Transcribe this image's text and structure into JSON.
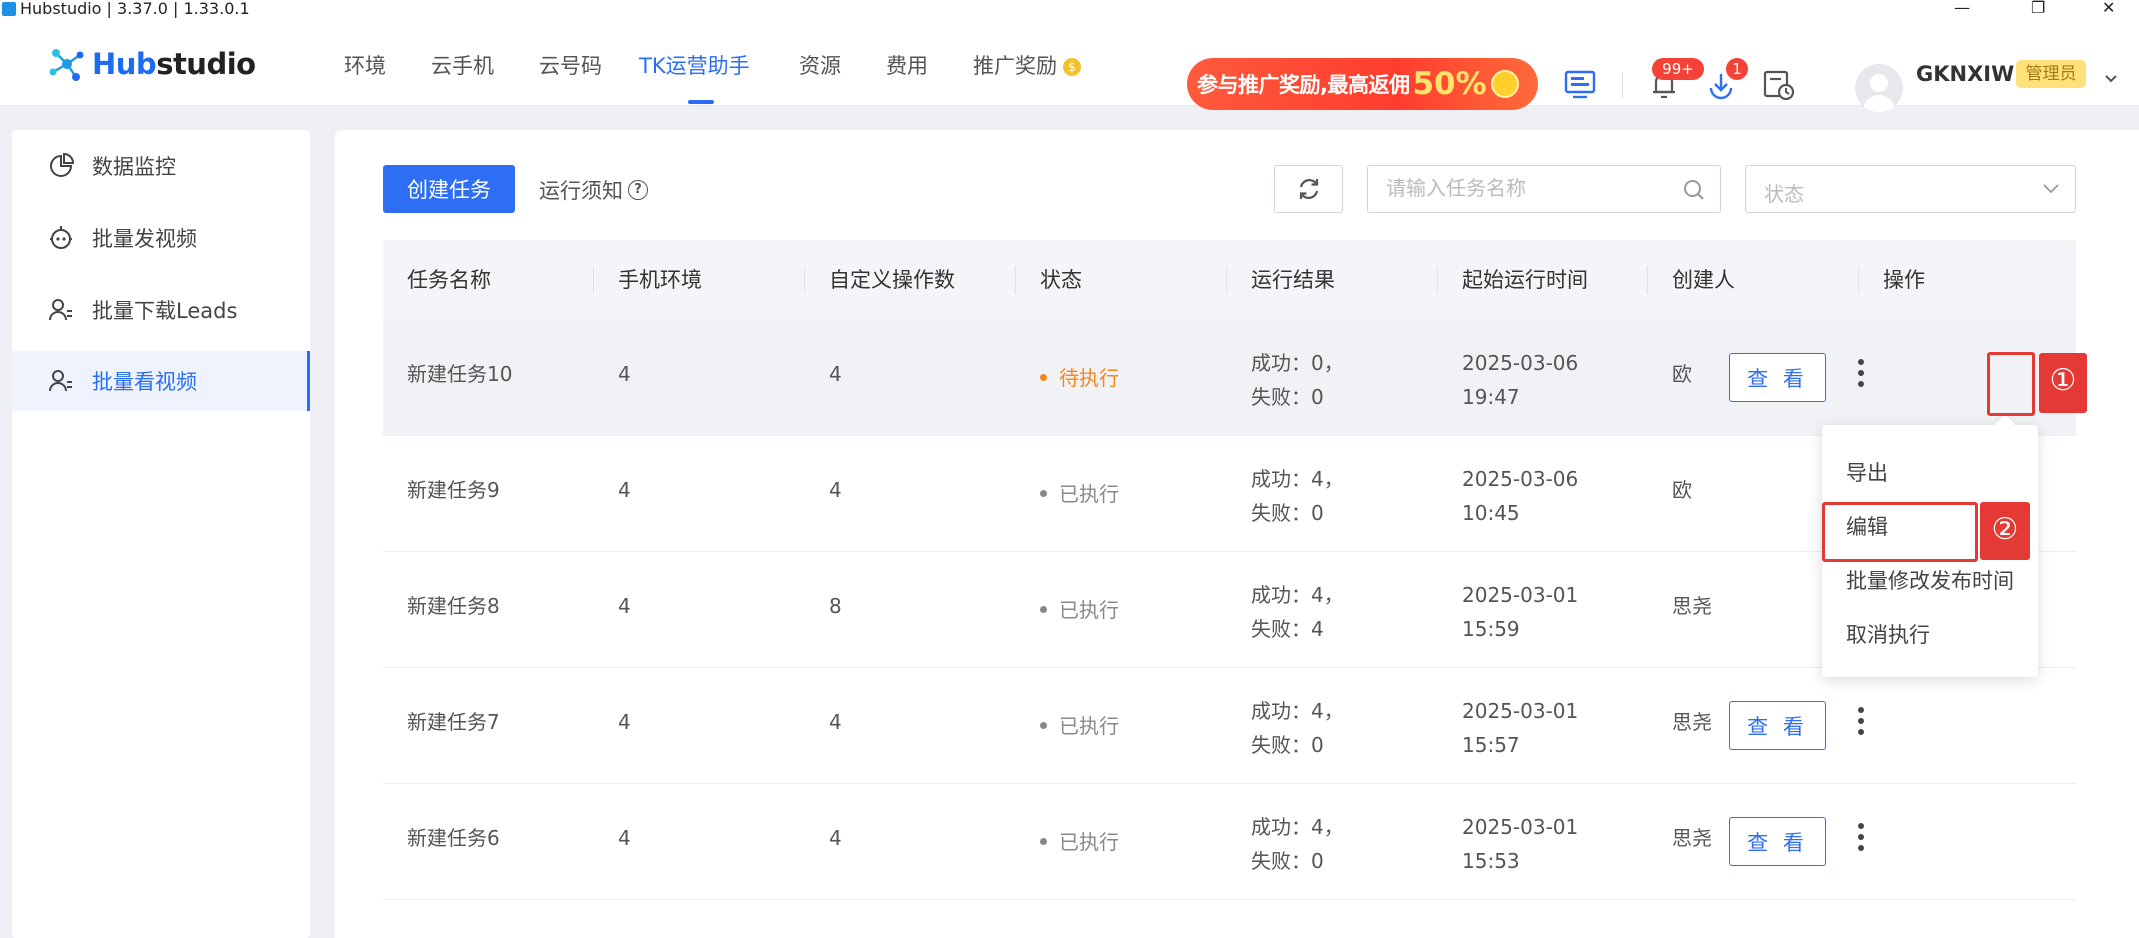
{
  "window": {
    "title": "Hubstudio | 3.37.0 | 1.33.0.1",
    "controls": [
      "—",
      "❐",
      "✕"
    ]
  },
  "logo": {
    "text_hub": "Hub",
    "text_studio": "studio"
  },
  "nav": {
    "items": [
      {
        "label": "环境"
      },
      {
        "label": "云手机"
      },
      {
        "label": "云号码"
      },
      {
        "label": "TK运营助手"
      },
      {
        "label": "资源"
      },
      {
        "label": "费用"
      },
      {
        "label": "推广奖励"
      }
    ],
    "active": "TK运营助手"
  },
  "promo": {
    "text": "参与推广奖励,最高返佣",
    "percent": "50%"
  },
  "header_icons": {
    "notification_badge": "99+",
    "download_badge": "1"
  },
  "user": {
    "name": "GKNXIW",
    "role": "管理员"
  },
  "sidebar": {
    "items": [
      {
        "label": "数据监控",
        "icon": "chart-pie-icon"
      },
      {
        "label": "批量发视频",
        "icon": "robot-icon"
      },
      {
        "label": "批量下载Leads",
        "icon": "user-group-icon"
      },
      {
        "label": "批量看视频",
        "icon": "user-group-icon"
      }
    ],
    "active": "批量看视频"
  },
  "toolbar": {
    "create_label": "创建任务",
    "notice_label": "运行须知",
    "search_placeholder": "请输入任务名称",
    "status_placeholder": "状态"
  },
  "table": {
    "columns": [
      "任务名称",
      "手机环境",
      "自定义操作数",
      "状态",
      "运行结果",
      "起始运行时间",
      "创建人",
      "操作"
    ],
    "view_label": "查 看",
    "rows": [
      {
        "name": "新建任务10",
        "env": "4",
        "ops": "4",
        "status": "待执行",
        "result_success": "成功：0，",
        "result_fail": "失败：0",
        "date": "2025-03-06",
        "time": "19:47",
        "creator": "欧"
      },
      {
        "name": "新建任务9",
        "env": "4",
        "ops": "4",
        "status": "已执行",
        "result_success": "成功：4，",
        "result_fail": "失败：0",
        "date": "2025-03-06",
        "time": "10:45",
        "creator": "欧"
      },
      {
        "name": "新建任务8",
        "env": "4",
        "ops": "8",
        "status": "已执行",
        "result_success": "成功：4，",
        "result_fail": "失败：4",
        "date": "2025-03-01",
        "time": "15:59",
        "creator": "思尧"
      },
      {
        "name": "新建任务7",
        "env": "4",
        "ops": "4",
        "status": "已执行",
        "result_success": "成功：4，",
        "result_fail": "失败：0",
        "date": "2025-03-01",
        "time": "15:57",
        "creator": "思尧"
      },
      {
        "name": "新建任务6",
        "env": "4",
        "ops": "4",
        "status": "已执行",
        "result_success": "成功：4，",
        "result_fail": "失败：0",
        "date": "2025-03-01",
        "time": "15:53",
        "creator": "思尧"
      }
    ]
  },
  "dropdown": {
    "items": [
      "导出",
      "编辑",
      "批量修改发布时间",
      "取消执行"
    ]
  },
  "annotations": {
    "step1": "①",
    "step2": "②"
  },
  "colors": {
    "accent": "#2e6ef5",
    "pending": "#f5871f",
    "annotation": "#e53935"
  }
}
